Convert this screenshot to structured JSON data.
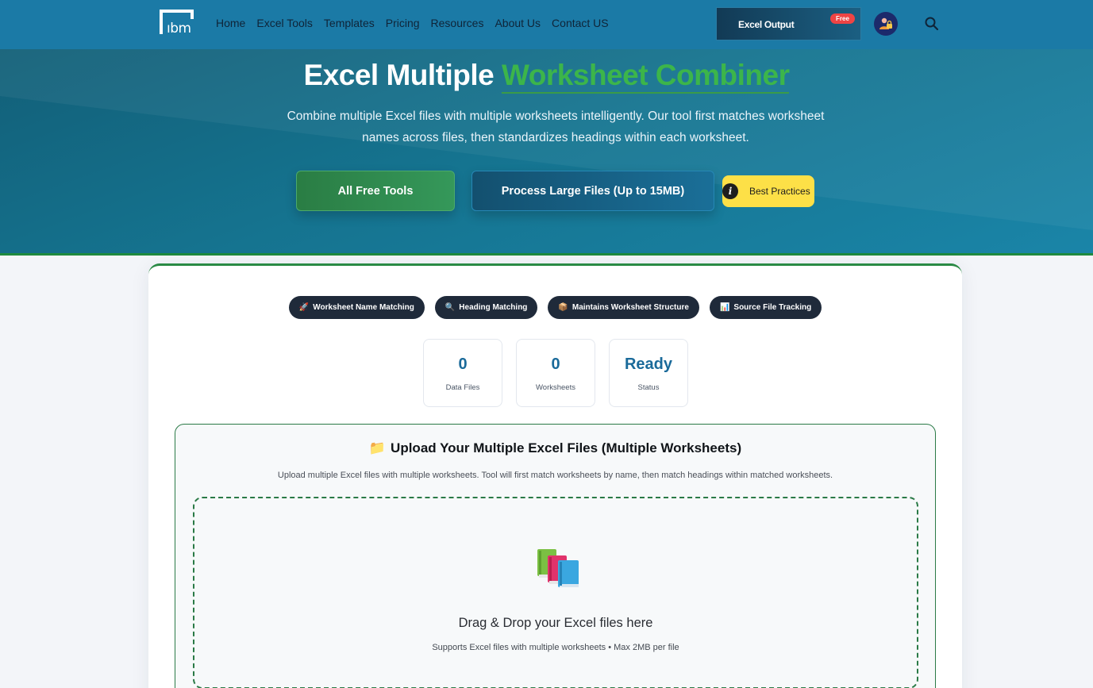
{
  "nav": {
    "menu": [
      "Home",
      "Excel Tools",
      "Templates",
      "Pricing",
      "Resources",
      "About Us",
      "Contact US"
    ],
    "promo": {
      "label": "Excel Output",
      "badge": "Free"
    }
  },
  "hero": {
    "title_main": "Excel Multiple",
    "title_accent": "Worksheet Combiner",
    "description": "Combine multiple Excel files with multiple worksheets intelligently. Our tool first matches worksheet names across files, then standardizes headings within each worksheet.",
    "buttons": {
      "all_tools": "All Free Tools",
      "large_files": "Process Large Files (Up to 15MB)",
      "best_practices": "Best Practices",
      "info_glyph": "i"
    }
  },
  "features": [
    {
      "icon": "🚀",
      "label": "Worksheet Name Matching"
    },
    {
      "icon": "🔍",
      "label": "Heading Matching"
    },
    {
      "icon": "📦",
      "label": "Maintains Worksheet Structure"
    },
    {
      "icon": "📊",
      "label": "Source File Tracking"
    }
  ],
  "stats": [
    {
      "value": "0",
      "label": "Data Files"
    },
    {
      "value": "0",
      "label": "Worksheets"
    },
    {
      "value": "Ready",
      "label": "Status"
    }
  ],
  "upload": {
    "icon": "📁",
    "title": "Upload Your Multiple Excel Files (Multiple Worksheets)",
    "description": "Upload multiple Excel files with multiple worksheets. Tool will first match worksheets by name, then match headings within matched worksheets.",
    "drop_title": "Drag & Drop your Excel files here",
    "drop_subtitle": "Supports Excel files with multiple worksheets • Max 2MB per file"
  },
  "colors": {
    "nav_bg": "#1b7aa6",
    "accent_green": "#3cb54a",
    "chip_bg": "#1f2a3a",
    "stat_value": "#1a6a9a",
    "best_practices_bg": "#fde047"
  }
}
